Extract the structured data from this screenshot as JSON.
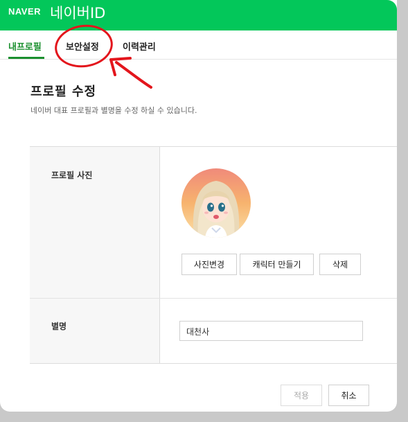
{
  "header": {
    "logo": "NAVER",
    "title": "네이버ID"
  },
  "tabs": [
    {
      "label": "내프로필",
      "active": true
    },
    {
      "label": "보안설정",
      "active": false
    },
    {
      "label": "이력관리",
      "active": false
    }
  ],
  "page": {
    "title": "프로필 수정",
    "description": "네이버 대표 프로필과 별명을 수정 하실 수 있습니다."
  },
  "profile_photo": {
    "label": "프로필 사진",
    "avatar_icon": "cartoon-girl-avatar",
    "buttons": {
      "change": "사진변경",
      "character": "캐릭터 만들기",
      "delete": "삭제"
    }
  },
  "alias": {
    "label": "별명",
    "value": "대천사"
  },
  "footer": {
    "apply": "적용",
    "cancel": "취소"
  },
  "colors": {
    "brand_green": "#03c75a",
    "active_tab": "#1a8f2e",
    "annotation_red": "#e3151c"
  }
}
